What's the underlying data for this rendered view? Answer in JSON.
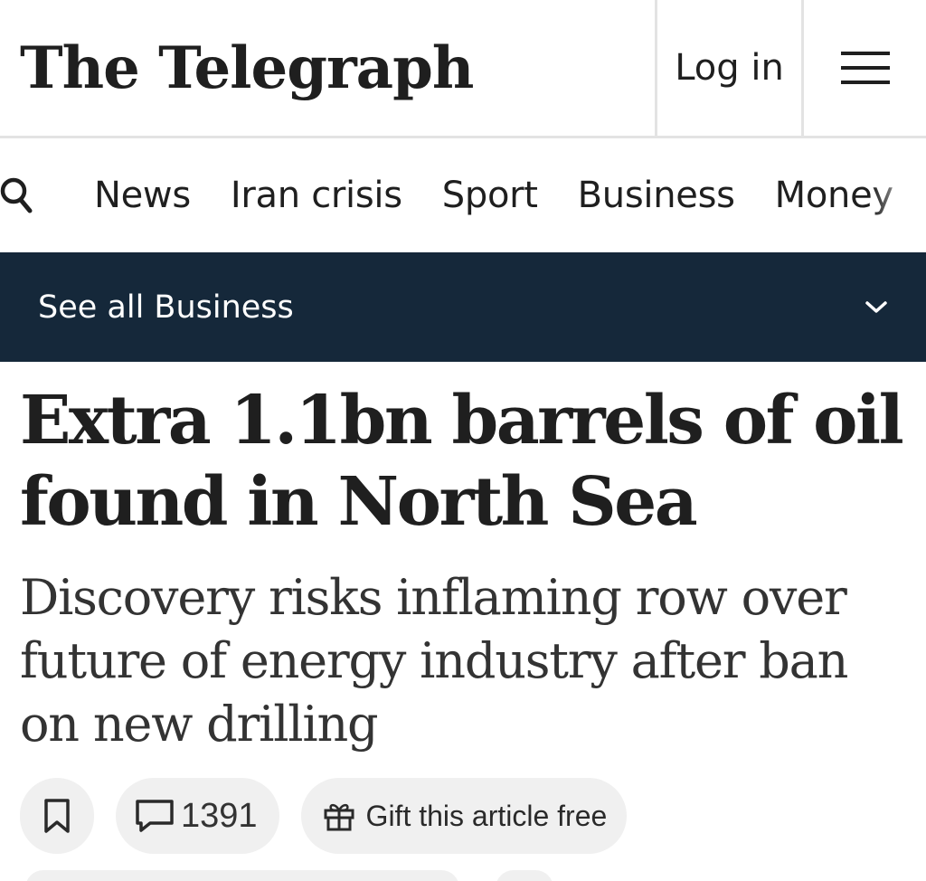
{
  "header": {
    "logo_text": "The Telegraph",
    "login_label": "Log in"
  },
  "nav": {
    "items": [
      "News",
      "Iran crisis",
      "Sport",
      "Business",
      "Money"
    ]
  },
  "section_bar": {
    "label": "See all Business"
  },
  "article": {
    "headline_line1": "Extra 1.1bn barrels of oil",
    "headline_line2": "found in North Sea",
    "standfirst_line1": "Discovery risks inflaming row over",
    "standfirst_line2": "future of energy industry after ban",
    "standfirst_line3": "on new drilling"
  },
  "actions": {
    "comment_count": "1391",
    "gift_label": "Gift this article free"
  },
  "icons": {
    "menu": "hamburger-menu-icon",
    "search": "search-icon",
    "section_toggle": "chevron-down-icon",
    "bookmark": "bookmark-icon",
    "comments": "comment-icon",
    "gift": "gift-icon"
  },
  "colors": {
    "section_bar_bg": "#15283a",
    "pill_bg": "#f0f0f0",
    "text": "#1f1f1f"
  }
}
